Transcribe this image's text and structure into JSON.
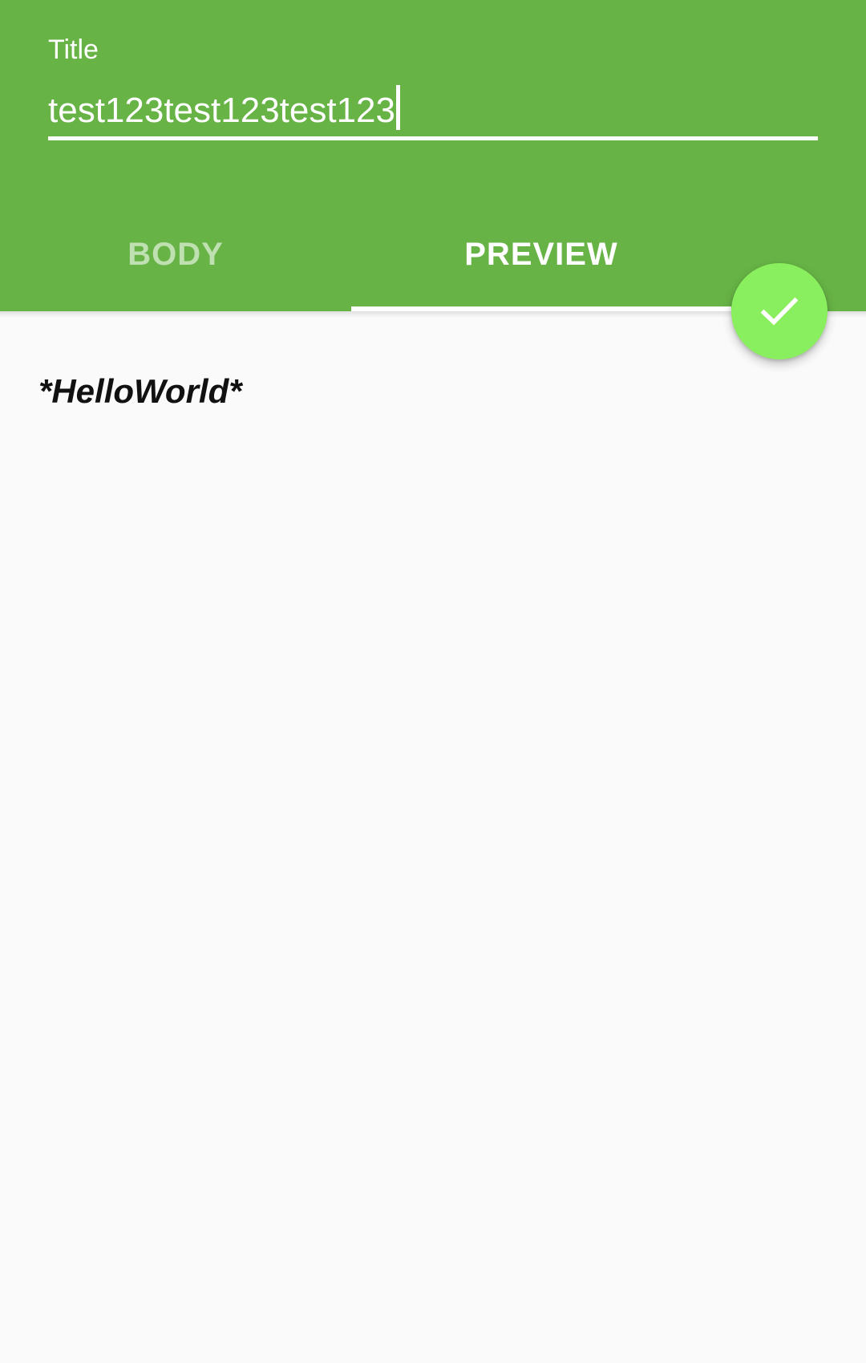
{
  "header": {
    "title_label": "Title",
    "title_value": "test123test123test123"
  },
  "tabs": [
    {
      "label": "BODY",
      "selected": false
    },
    {
      "label": "PREVIEW",
      "selected": true
    }
  ],
  "preview": {
    "content": "*HelloWorld*"
  },
  "fab": {
    "icon": "check-icon"
  },
  "colors": {
    "primary": "#67b346",
    "accent": "#8aef5e",
    "inactive_tab": "#bfe0b0",
    "background": "#fafafa"
  }
}
